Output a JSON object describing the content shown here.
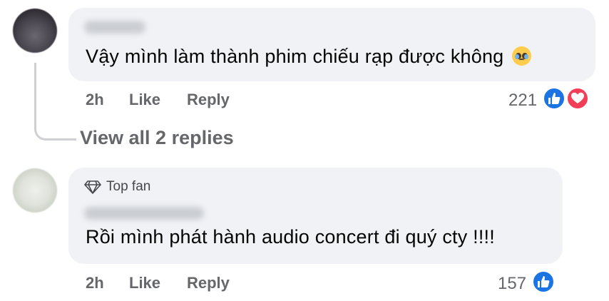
{
  "comments": [
    {
      "text": "Vậy mình làm thành phim chiếu rạp được không",
      "emoji": "pleading-face",
      "time": "2h",
      "like_label": "Like",
      "reply_label": "Reply",
      "reaction_count": "221",
      "reactions": [
        "like",
        "love"
      ]
    },
    {
      "badge": "Top fan",
      "text": "Rồi mình phát hành audio concert đi quý cty !!!!",
      "time": "2h",
      "like_label": "Like",
      "reply_label": "Reply",
      "reaction_count": "157",
      "reactions": [
        "like"
      ]
    }
  ],
  "view_replies_label": "View all 2 replies",
  "colors": {
    "bubble": "#f0f2f5",
    "meta": "#65676b",
    "like": "#1b74e4",
    "love": "#f33e58"
  }
}
